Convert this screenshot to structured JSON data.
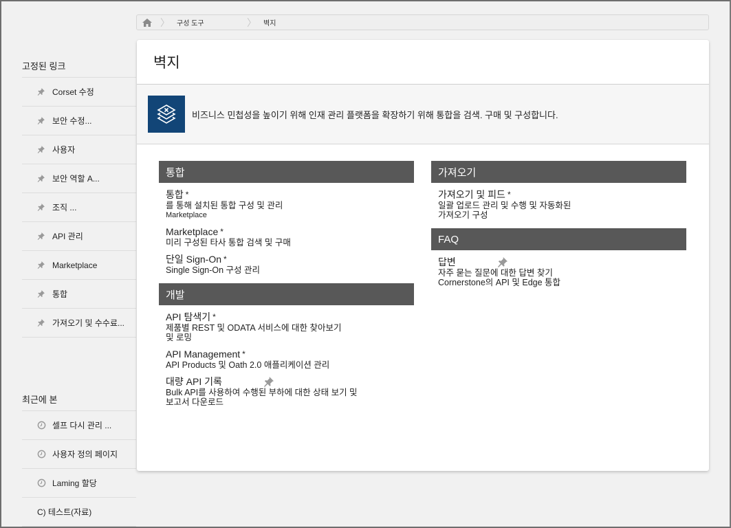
{
  "breadcrumb": {
    "home_icon": "home-icon",
    "items": [
      "구성 도구",
      "벽지"
    ]
  },
  "sidebar": {
    "pinned_heading": "고정된 링크",
    "pinned_items": [
      {
        "label": "Corset 수정",
        "icon": "pin-icon"
      },
      {
        "label": "보안 수정...",
        "icon": "pin-icon"
      },
      {
        "label": "사용자",
        "icon": "pin-icon"
      },
      {
        "label": "보안 역할 A...",
        "icon": "pin-icon"
      },
      {
        "label": "조직 ...",
        "icon": "pin-icon"
      },
      {
        "label": "API 관리",
        "icon": "pin-icon"
      },
      {
        "label": "Marketplace",
        "icon": "pin-icon"
      },
      {
        "label": "통합",
        "icon": "pin-icon"
      },
      {
        "label": "가져오기 및 수수료...",
        "icon": "pin-icon"
      }
    ],
    "recent_heading": "최근에 본",
    "recent_items": [
      {
        "label": "셀프 다시 관리 ...",
        "icon": "clock-icon"
      },
      {
        "label": "사용자 정의 페이지",
        "icon": "clock-icon"
      },
      {
        "label": "Laming 할당",
        "icon": "clock-icon"
      },
      {
        "label": "C) 테스트(자료)",
        "icon": ""
      }
    ]
  },
  "card": {
    "title": "벽지",
    "banner_icon": "layers-icon",
    "banner_text": "비즈니스 민첩성을 높이기 위해 인재 관리 플랫폼을 확장하기 위해 통합을 검색. 구매 및 구성합니다.",
    "colors": {
      "banner_icon_bg": "#124577",
      "section_header_bg": "#585858"
    },
    "left_sections": [
      {
        "header": "통합",
        "entries": [
          {
            "title": "통합",
            "star": "*",
            "desc": "를 통해 설치된 통합 구성 및 관리",
            "desc2": "Marketplace"
          },
          {
            "title": "Marketplace",
            "star": "*",
            "desc": "미리 구성된 타사 통합 검색 및 구매",
            "desc2": ""
          },
          {
            "title": "단일 Sign-On",
            "star": "*",
            "desc": "Single Sign-On 구성 관리",
            "desc2": ""
          }
        ]
      },
      {
        "header": "개발",
        "entries": [
          {
            "title": "API 탐색기",
            "star": "*",
            "desc": "제품별 REST 및 ODATA 서비스에 대한 찾아보기",
            "desc2": "및 로밍"
          },
          {
            "title": "API Management",
            "star": "*",
            "desc": "API Products 및 Oath 2.0 애플리케이션 관리",
            "desc2": ""
          },
          {
            "title": "대량 API 기록",
            "star": "",
            "pin": true,
            "desc": "Bulk API를 사용하여 수행된 부하에 대한 상태 보기 및",
            "desc2": "보고서 다운로드"
          }
        ]
      }
    ],
    "right_sections": [
      {
        "header": "가져오기",
        "entries": [
          {
            "title": "가져오기 및 피드",
            "star": "*",
            "desc": "일괄 업로드 관리 및 수행 및 자동화된",
            "desc2": "가져오기 구성"
          }
        ]
      },
      {
        "header": "FAQ",
        "entries": [
          {
            "title": "답변",
            "star": "",
            "pin": true,
            "desc": "자주 묻는 질문에 대한 답변 찾기",
            "desc2": "Cornerstone의 API 및 Edge 통합"
          }
        ]
      }
    ]
  }
}
